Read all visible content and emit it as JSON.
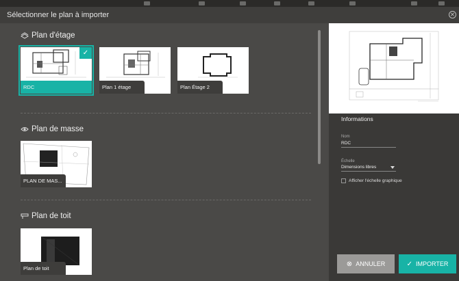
{
  "dialog": {
    "title": "Sélectionner le plan à importer"
  },
  "sections": {
    "floor": {
      "title": "Plan d'étage",
      "icon": "floor-plan-icon",
      "items": [
        {
          "label": "RDC",
          "selected": true
        },
        {
          "label": "Plan 1 étage",
          "selected": false
        },
        {
          "label": "Plan Étage 2",
          "selected": false
        }
      ]
    },
    "mass": {
      "title": "Plan de masse",
      "icon": "eye-icon",
      "items": [
        {
          "label": "PLAN DE MAS...",
          "selected": false
        }
      ]
    },
    "roof": {
      "title": "Plan de toit",
      "icon": "roof-icon",
      "items": [
        {
          "label": "Plan de toit",
          "selected": false
        }
      ]
    }
  },
  "info": {
    "title": "Informations",
    "name_label": "Nom",
    "name_value": "RDC",
    "scale_label": "Échelle",
    "scale_value": "Dimensions libres",
    "graphic_scale_label": "Afficher l'échelle graphique",
    "graphic_scale_checked": false
  },
  "buttons": {
    "cancel": "ANNULER",
    "import": "IMPORTER"
  },
  "colors": {
    "accent": "#18b3a6",
    "panel": "#4a4947",
    "sidebar": "#3a3937",
    "cancel": "#9b9a98"
  }
}
